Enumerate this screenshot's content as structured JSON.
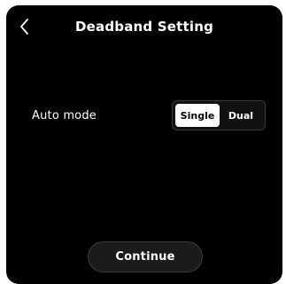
{
  "header": {
    "title": "Deadband Setting",
    "back_icon": "chevron-left-icon"
  },
  "auto_mode": {
    "label": "Auto mode",
    "options": [
      "Single",
      "Dual"
    ],
    "selected": "Single"
  },
  "footer": {
    "continue_label": "Continue"
  },
  "colors": {
    "background": "#000000",
    "text": "#ffffff",
    "segment_active_bg": "#ffffff",
    "button_bg": "#1b1b1b"
  }
}
